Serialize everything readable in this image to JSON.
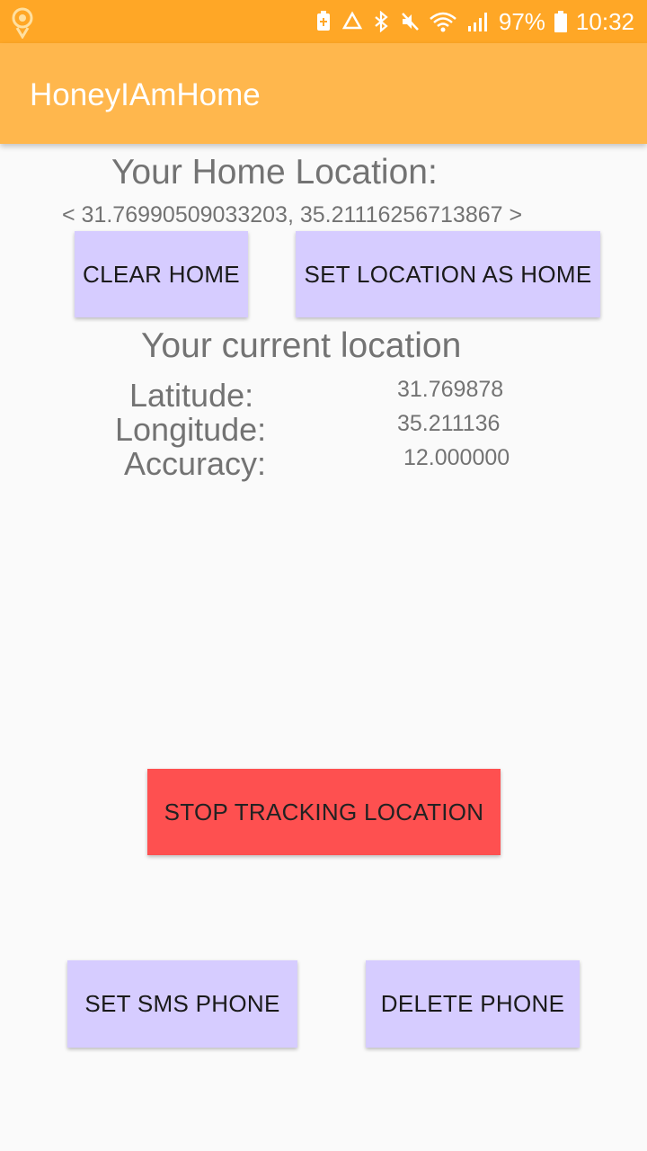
{
  "status_bar": {
    "battery": "97%",
    "time": "10:32",
    "icons": [
      "location-pin-icon",
      "battery-saver-icon",
      "recycle-icon",
      "bluetooth-icon",
      "mute-icon",
      "wifi-icon",
      "signal-icon",
      "battery-icon"
    ]
  },
  "app_bar": {
    "title": "HoneyIAmHome"
  },
  "home": {
    "heading": "Your Home Location:",
    "coords": "< 31.76990509033203, 35.21116256713867 >"
  },
  "buttons": {
    "clear_home": "CLEAR HOME",
    "set_home": "SET LOCATION AS HOME",
    "stop_tracking": "STOP TRACKING LOCATION",
    "set_sms_phone": "SET SMS PHONE",
    "delete_phone": "DELETE PHONE"
  },
  "current": {
    "heading": "Your current location",
    "latitude_label": "Latitude:",
    "latitude_value": "31.769878",
    "longitude_label": "Longitude:",
    "longitude_value": "35.211136",
    "accuracy_label": "Accuracy:",
    "accuracy_value": "12.000000"
  },
  "colors": {
    "status_bar": "#ffa726",
    "app_bar": "#ffb74d",
    "button": "#d6ccff",
    "stop_button": "#fe5050",
    "background": "#fafafa"
  }
}
